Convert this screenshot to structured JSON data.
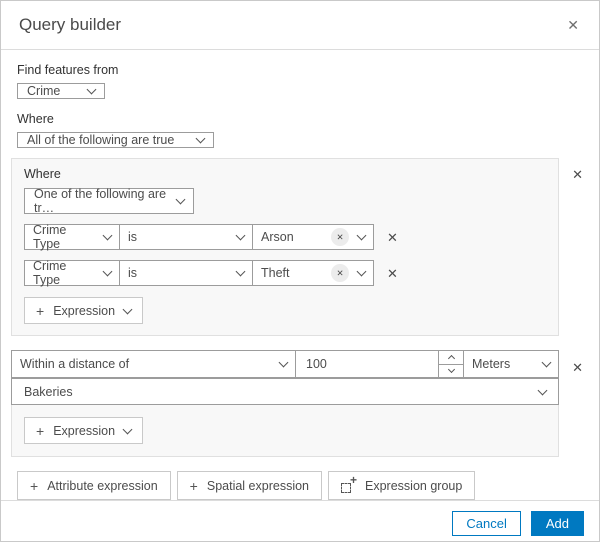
{
  "colors": {
    "accent": "#0079c1",
    "group_bg": "#f8f8f8",
    "control_border": "#9c9c9c"
  },
  "icons": {
    "close": "✕",
    "remove": "✕",
    "chip_remove": "✕",
    "plus": "+"
  },
  "dialog": {
    "title": "Query builder"
  },
  "find_features": {
    "label": "Find features from",
    "layer_value": "Crime"
  },
  "where": {
    "label": "Where",
    "operator_value": "All of the following are true"
  },
  "group1": {
    "label": "Where",
    "operator_value": "One of the following are tr…",
    "rows": [
      {
        "field": "Crime Type",
        "operator": "is",
        "value": "Arson"
      },
      {
        "field": "Crime Type",
        "operator": "is",
        "value": "Theft"
      }
    ],
    "add_expression_label": "Expression"
  },
  "group2": {
    "operator_value": "Within a distance of",
    "distance_value": "100",
    "unit_value": "Meters",
    "layer_value": "Bakeries",
    "add_expression_label": "Expression"
  },
  "actions": {
    "attribute_expression": "Attribute expression",
    "spatial_expression": "Spatial expression",
    "expression_group": "Expression group"
  },
  "footer": {
    "cancel": "Cancel",
    "add": "Add"
  }
}
